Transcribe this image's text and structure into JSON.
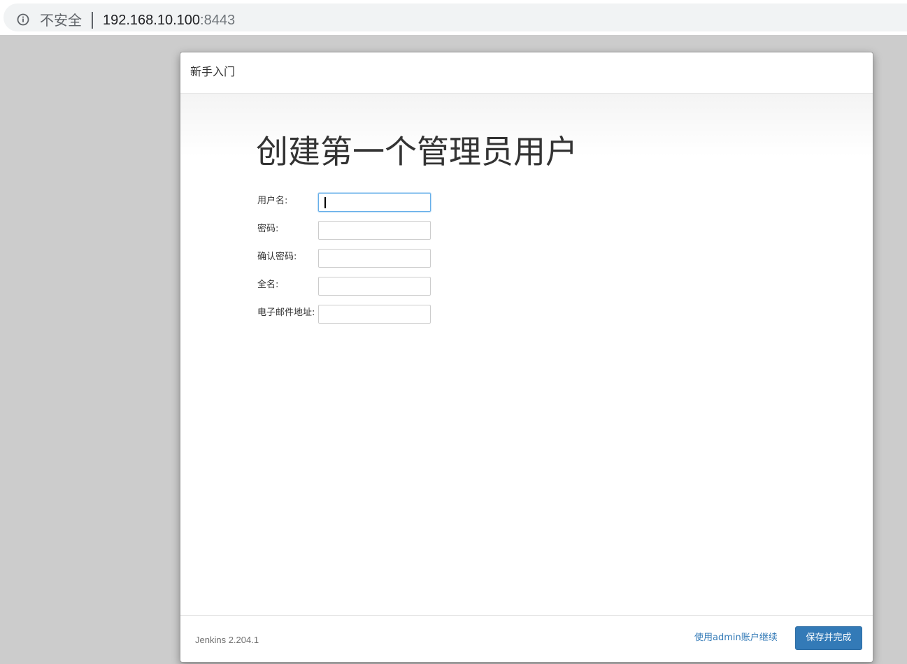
{
  "browser": {
    "security_label": "不安全",
    "url_host": "192.168.10.100",
    "url_port": ":8443",
    "icon": "info-icon"
  },
  "dialog": {
    "title": "新手入门",
    "heading": "创建第一个管理员用户",
    "fields": [
      {
        "label": "用户名:",
        "value": "",
        "focused": true
      },
      {
        "label": "密码:",
        "value": ""
      },
      {
        "label": "确认密码:",
        "value": ""
      },
      {
        "label": "全名:",
        "value": ""
      },
      {
        "label": "电子邮件地址:",
        "value": ""
      }
    ],
    "footer": {
      "version": "Jenkins 2.204.1",
      "skip_link": "使用admin账户继续",
      "save_button": "保存并完成"
    }
  },
  "colors": {
    "primary": "#337ab7",
    "backdrop": "#cccccc",
    "focus": "#66afe9"
  }
}
